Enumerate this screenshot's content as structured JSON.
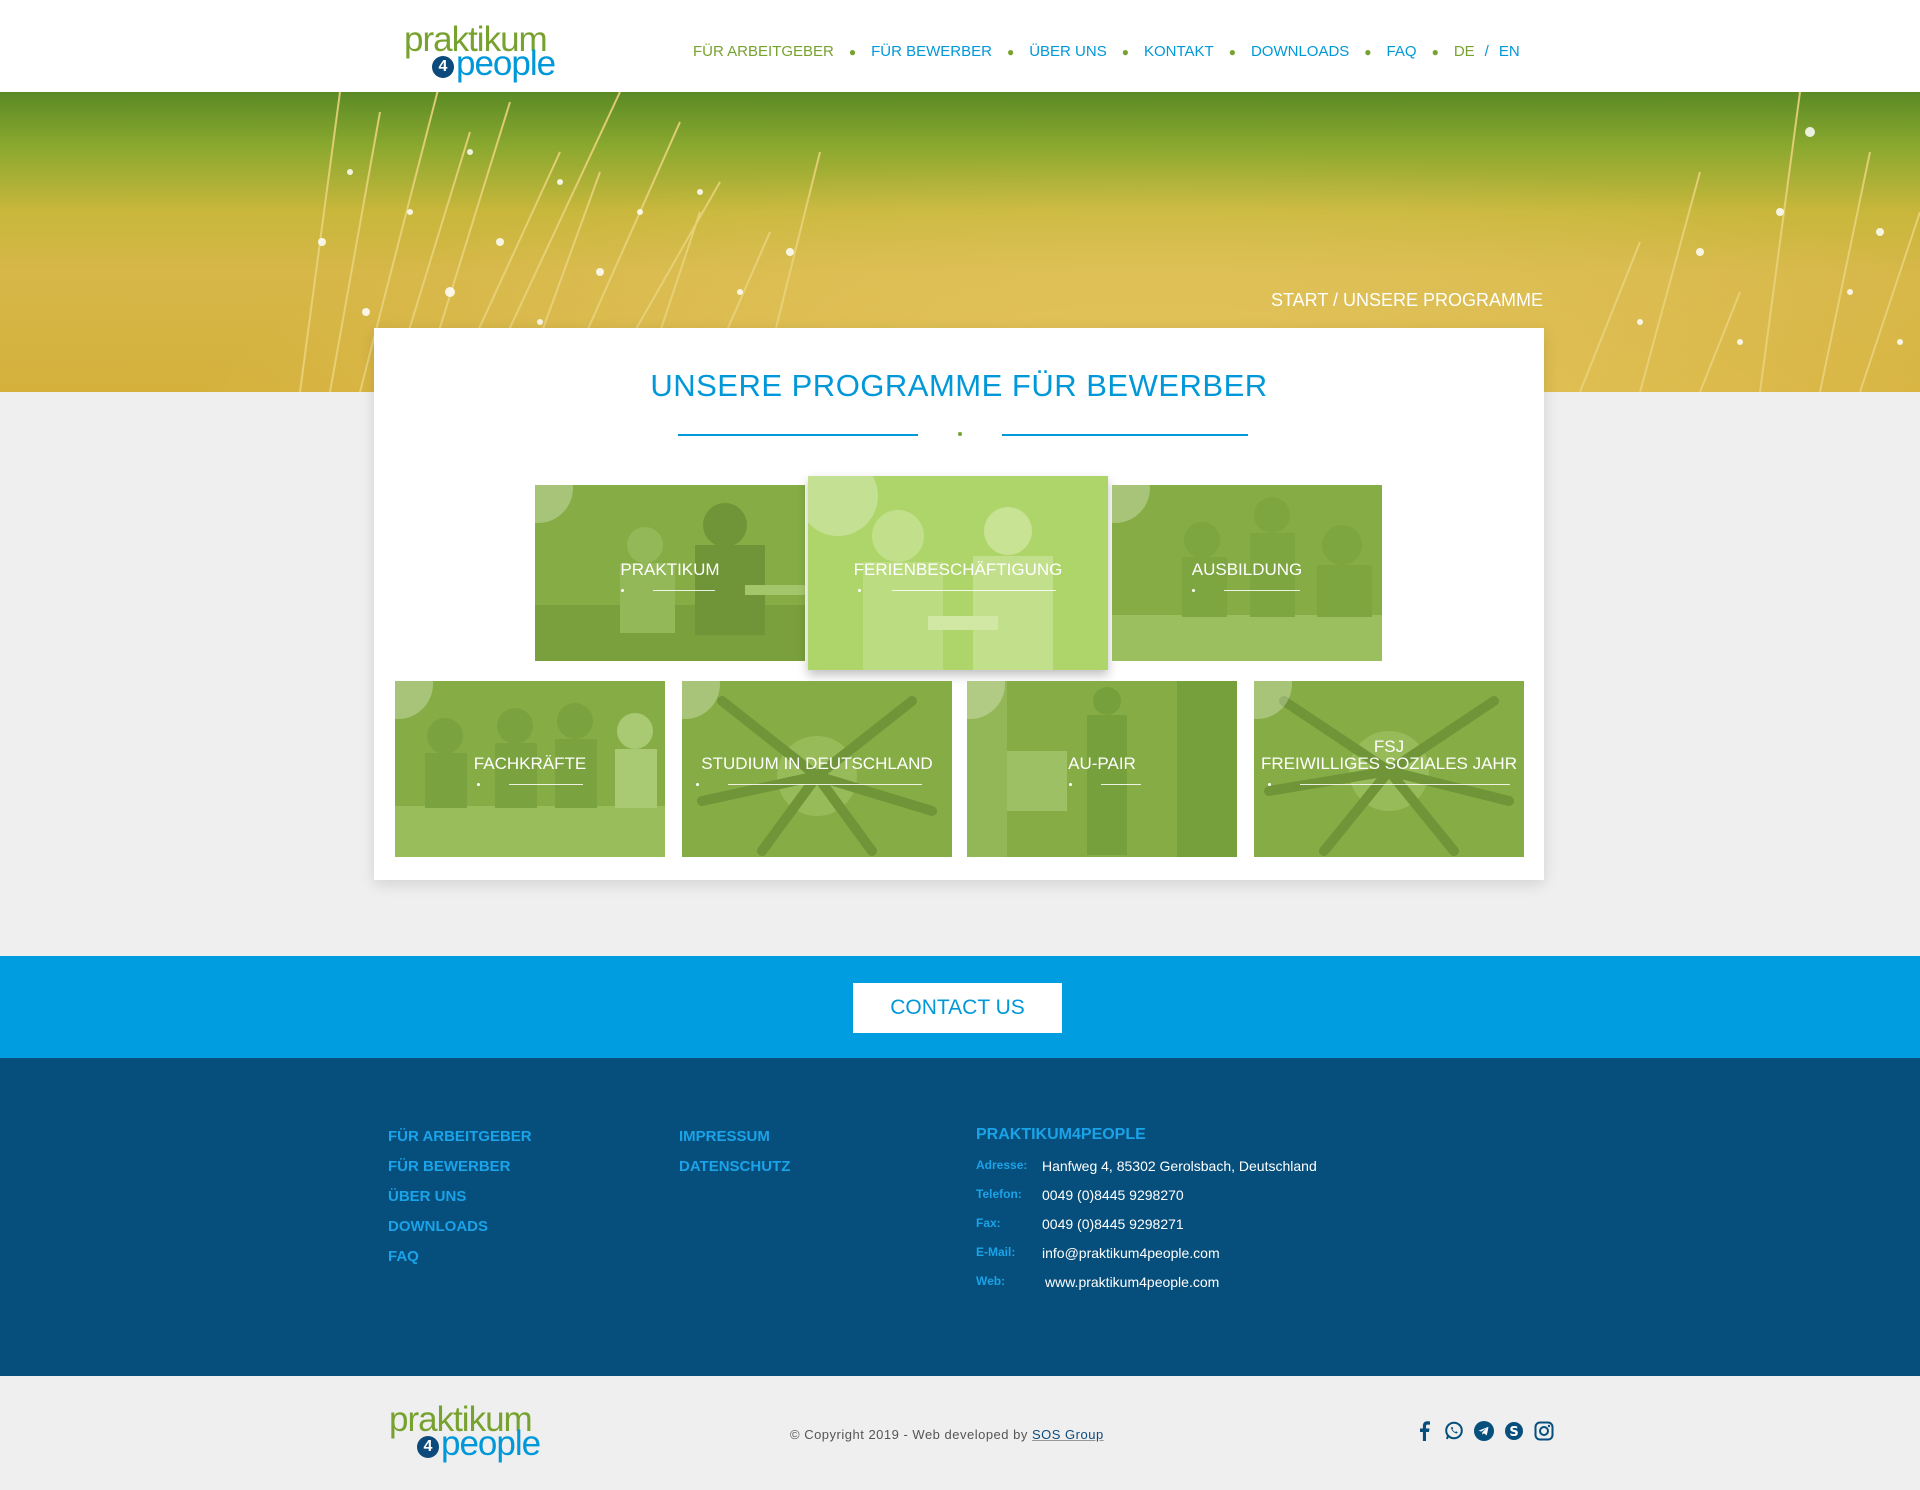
{
  "brand": {
    "logo_line1": "praktikum",
    "logo_four": "4",
    "logo_line2": "people"
  },
  "nav": {
    "items": [
      "FÜR ARBEITGEBER",
      "FÜR BEWERBER",
      "ÜBER UNS",
      "KONTAKT",
      "DOWNLOADS",
      "FAQ"
    ],
    "lang_de": "DE",
    "lang_sep": "/",
    "lang_en": "EN"
  },
  "hero": {
    "breadcrumb": "START / UNSERE PROGRAMME"
  },
  "main": {
    "title": "UNSERE PROGRAMME FÜR BEWERBER",
    "programs": [
      {
        "label": "PRAKTIKUM"
      },
      {
        "label": "FERIENBESCHÄFTIGUNG"
      },
      {
        "label": "AUSBILDUNG"
      },
      {
        "label": "FACHKRÄFTE"
      },
      {
        "label": "STUDIUM IN DEUTSCHLAND"
      },
      {
        "label": "AU-PAIR"
      },
      {
        "label": "FSJ",
        "label2": "FREIWILLIGES SOZIALES JAHR"
      }
    ]
  },
  "contact": {
    "button": "CONTACT US"
  },
  "footer": {
    "col1": [
      "FÜR ARBEITGEBER",
      "FÜR BEWERBER",
      "ÜBER UNS",
      "DOWNLOADS",
      "FAQ"
    ],
    "col2": [
      "IMPRESSUM",
      "DATENSCHUTZ"
    ],
    "company": "PRAKTIKUM4PEOPLE",
    "details": [
      {
        "k": "Adresse:",
        "v": "Hanfweg 4, 85302 Gerolsbach, Deutschland"
      },
      {
        "k": "Telefon:",
        "v": "0049 (0)8445 9298270"
      },
      {
        "k": "Fax:",
        "v": "0049 (0)8445 9298271"
      },
      {
        "k": "E-Mail:",
        "v": "info@praktikum4people.com"
      },
      {
        "k": "Web:",
        "v": "www.praktikum4people.com"
      }
    ]
  },
  "bottom": {
    "copyright": "© Copyright 2019 - Web developed by",
    "developer": "SOS Group",
    "socials": [
      "facebook-icon",
      "whatsapp-icon",
      "telegram-icon",
      "skype-icon",
      "instagram-icon"
    ]
  },
  "colors": {
    "green": "#78a22f",
    "blue": "#0098d8",
    "dark_blue": "#064f7c",
    "tile_green": "#86ad45",
    "tile_active": "#aed56a"
  }
}
